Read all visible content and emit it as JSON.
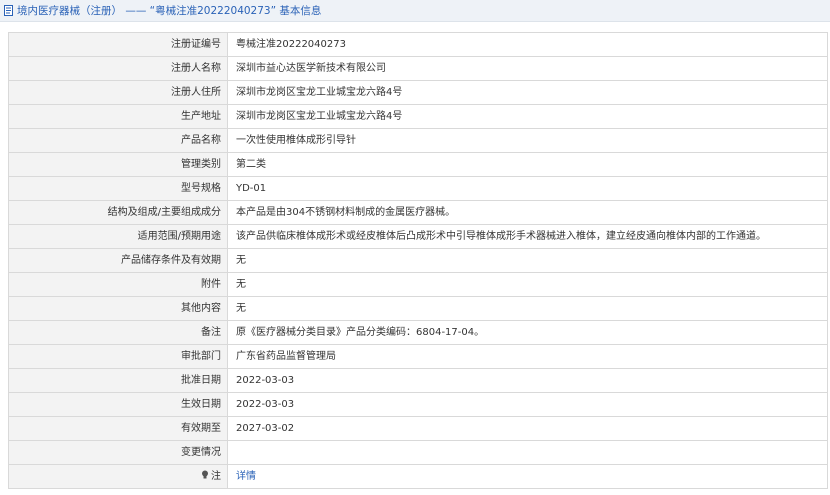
{
  "header": {
    "title": "境内医疗器械（注册） —— “粤械注准20222040273” 基本信息"
  },
  "rows": [
    {
      "label": "注册证编号",
      "value": "粤械注准20222040273"
    },
    {
      "label": "注册人名称",
      "value": "深圳市益心达医学新技术有限公司"
    },
    {
      "label": "注册人住所",
      "value": "深圳市龙岗区宝龙工业城宝龙六路4号"
    },
    {
      "label": "生产地址",
      "value": "深圳市龙岗区宝龙工业城宝龙六路4号"
    },
    {
      "label": "产品名称",
      "value": "一次性使用椎体成形引导针"
    },
    {
      "label": "管理类别",
      "value": "第二类"
    },
    {
      "label": "型号规格",
      "value": "YD-01"
    },
    {
      "label": "结构及组成/主要组成成分",
      "value": "本产品是由304不锈钢材料制成的金属医疗器械。"
    },
    {
      "label": "适用范围/预期用途",
      "value": "该产品供临床椎体成形术或经皮椎体后凸成形术中引导椎体成形手术器械进入椎体，建立经皮通向椎体内部的工作通道。"
    },
    {
      "label": "产品储存条件及有效期",
      "value": "无"
    },
    {
      "label": "附件",
      "value": "无"
    },
    {
      "label": "其他内容",
      "value": "无"
    },
    {
      "label": "备注",
      "value": "原《医疗器械分类目录》产品分类编码：6804-17-04。"
    },
    {
      "label": "审批部门",
      "value": "广东省药品监督管理局"
    },
    {
      "label": "批准日期",
      "value": "2022-03-03"
    },
    {
      "label": "生效日期",
      "value": "2022-03-03"
    },
    {
      "label": "有效期至",
      "value": "2027-03-02"
    },
    {
      "label": "变更情况",
      "value": ""
    }
  ],
  "note_row": {
    "label": "注",
    "link": "详情",
    "icon": "lightbulb-icon"
  },
  "colors": {
    "link": "#2a62b7",
    "label_bg": "#f3f3f3",
    "border": "#d9d9d9",
    "header_bg": "#eef2f7"
  }
}
